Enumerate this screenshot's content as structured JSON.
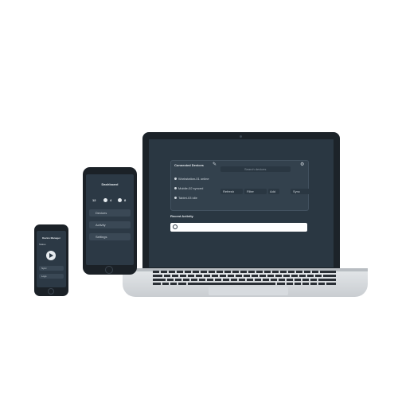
{
  "laptop": {
    "panel_title": "Connected Devices",
    "panel_icon": "edit-icon",
    "search_placeholder": "Search devices",
    "list_items": [
      "Workstation-01 online",
      "Mobile-02 synced",
      "Tablet-03 idle"
    ],
    "buttons": [
      "Refresh",
      "Filter",
      "Add",
      "Sync"
    ],
    "section_title": "Recent Activity",
    "input_icon": "plus-circle-icon"
  },
  "phone_medium": {
    "title": "Dashboard",
    "stats": [
      "12",
      "4",
      "8"
    ],
    "rows": [
      "Devices",
      "Activity",
      "Settings"
    ]
  },
  "phone_small": {
    "title": "Device Manager",
    "subtitle": "Status",
    "action_icon": "play-icon",
    "rows": [
      "Sync",
      "Logs"
    ]
  },
  "colors": {
    "screen": "#2a3742",
    "panel": "#33414d",
    "bezel": "#1c2329",
    "accent": "#e6ebef"
  }
}
